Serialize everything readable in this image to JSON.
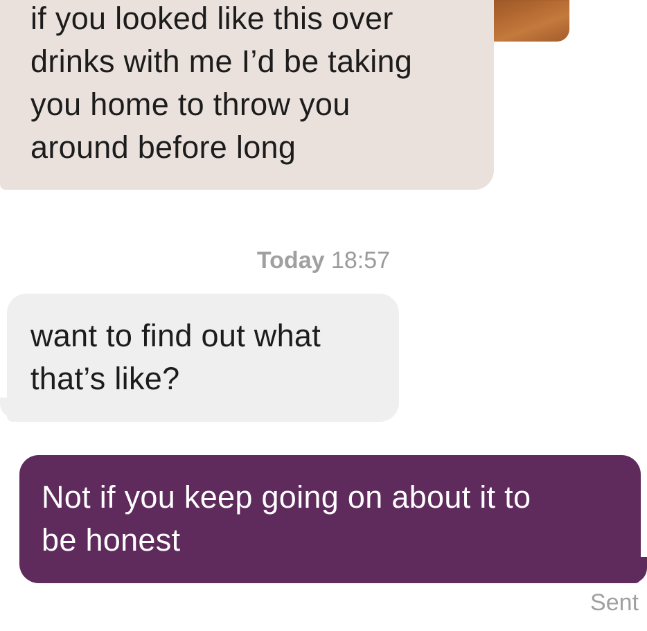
{
  "messages": [
    {
      "direction": "received",
      "text": "if you looked like this over\ndrinks with me I’d be taking\nyou home to throw you\naround before long"
    },
    {
      "direction": "received",
      "text": "want to find out what\nthat’s like?"
    },
    {
      "direction": "sent",
      "text": "Not if you keep going on about it to\nbe honest"
    }
  ],
  "timestamp": {
    "day": "Today",
    "time": "18:57"
  },
  "delivery_status": "Sent",
  "colors": {
    "received_photo_reply_bubble": "#eae1dc",
    "received_bubble": "#efefef",
    "sent_bubble": "#5f2a5c",
    "meta_text": "#9b9b9b"
  }
}
